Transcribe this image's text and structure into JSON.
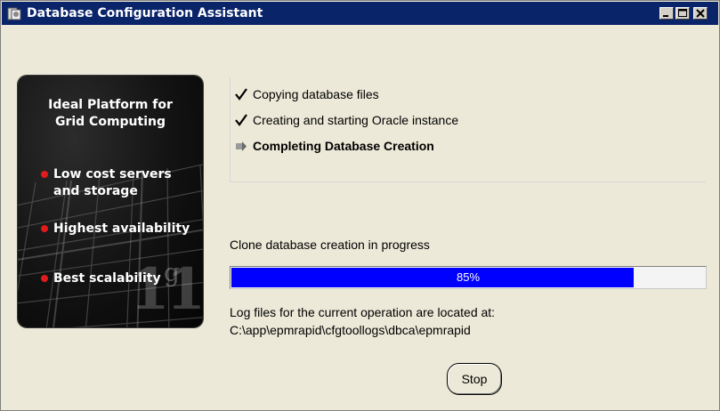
{
  "window": {
    "title": "Database Configuration Assistant",
    "icons": {
      "app": "database-app-icon",
      "minimize": "minimize-icon",
      "maximize": "maximize-icon",
      "close": "close-icon"
    }
  },
  "banner": {
    "heading_line1": "Ideal Platform for",
    "heading_line2": "Grid Computing",
    "bullets": [
      {
        "line1": "Low cost servers",
        "line2": "and storage"
      },
      {
        "line1": "Highest availability"
      },
      {
        "line1": "Best scalability"
      }
    ],
    "logo_number": "11",
    "logo_letter": "g",
    "colors": {
      "bullet": "#e01b1b",
      "background": "#121212"
    }
  },
  "steps": [
    {
      "label": "Copying database files",
      "status": "done",
      "icon": "checkmark-icon"
    },
    {
      "label": "Creating and starting Oracle instance",
      "status": "done",
      "icon": "checkmark-icon"
    },
    {
      "label": "Completing Database Creation",
      "status": "in-progress",
      "icon": "in-progress-arrow-icon"
    }
  ],
  "progress": {
    "status_text": "Clone database creation in progress",
    "percent": 85,
    "percent_label": "85%",
    "bar_color": "#0000ff"
  },
  "log": {
    "line1": "Log files for the current operation are located at:",
    "line2": "C:\\app\\epmrapid\\cfgtoollogs\\dbca\\epmrapid"
  },
  "buttons": {
    "stop_label": "Stop"
  }
}
